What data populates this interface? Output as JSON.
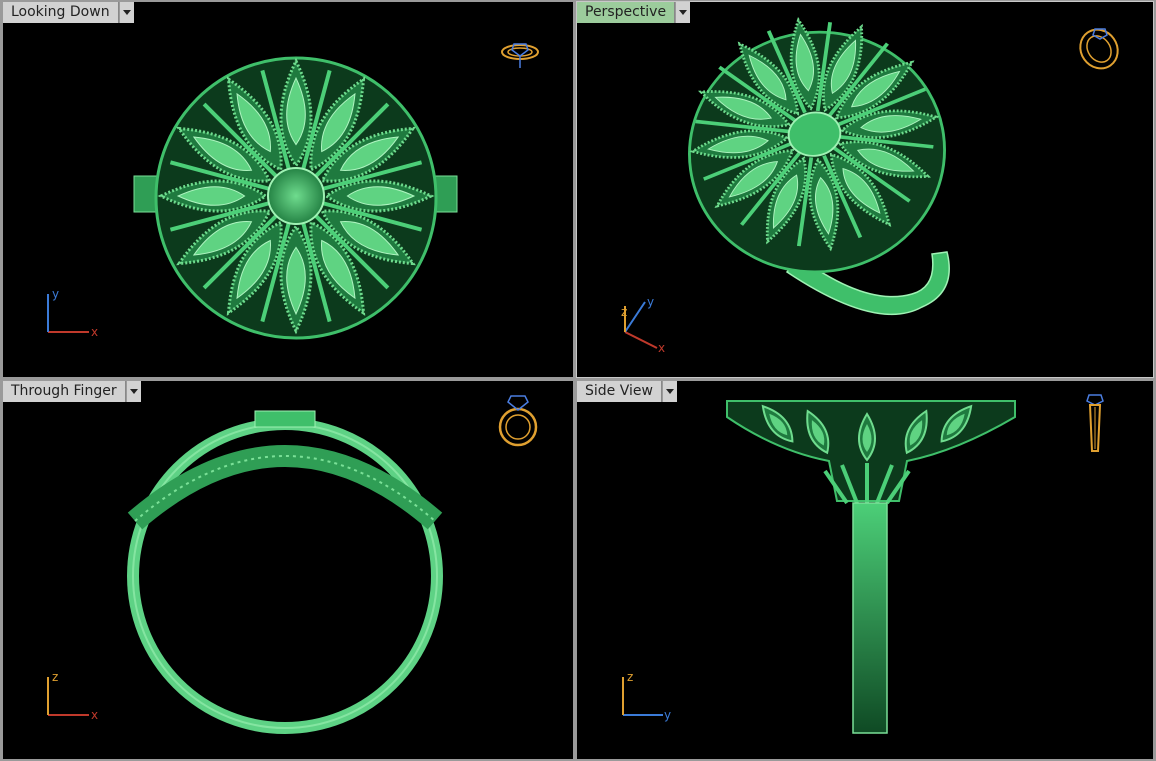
{
  "viewports": [
    {
      "id": "top",
      "title": "Looking Down",
      "axes": {
        "horizontal": "x",
        "vertical": "y"
      },
      "active": false
    },
    {
      "id": "perspective",
      "title": "Perspective",
      "axes": {
        "a": "z",
        "b": "y",
        "c": "x"
      },
      "active": true
    },
    {
      "id": "front",
      "title": "Through Finger",
      "axes": {
        "horizontal": "x",
        "vertical": "z"
      },
      "active": false
    },
    {
      "id": "side",
      "title": "Side View",
      "axes": {
        "horizontal": "y",
        "vertical": "z"
      },
      "active": false
    }
  ],
  "colors": {
    "model": "#3fbf6a",
    "model_dark": "#1f7a3f",
    "model_light": "#7fe39a",
    "x_axis": "#c0392b",
    "y_axis": "#3b7bd8",
    "z_axis": "#e0a030",
    "gizmo_ring": "#e0a030",
    "gizmo_gem": "#4a7de0",
    "background": "#000000"
  },
  "icons": [
    "ring-orientation-icon",
    "dropdown-arrow-icon",
    "axis-triad-icon"
  ]
}
